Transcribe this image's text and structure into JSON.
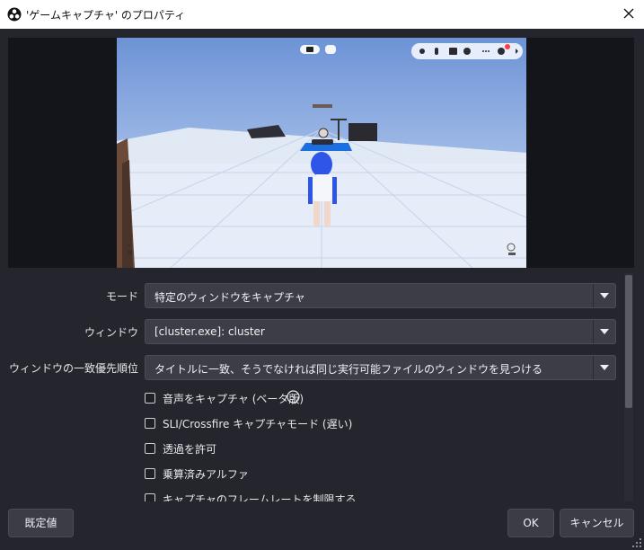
{
  "window": {
    "title": "'ゲームキャプチャ' のプロパティ",
    "icons": {
      "app": "obs-logo-icon",
      "close": "close-icon"
    }
  },
  "preview": {
    "description": "game-capture-preview",
    "hud_icons": [
      "chat-icon",
      "mic-muted-icon",
      "camera-icon",
      "emoji-icon",
      "more-icon",
      "settings-icon",
      "chevron-right-icon"
    ]
  },
  "form": {
    "mode": {
      "label": "モード",
      "value": "特定のウィンドウをキャプチャ"
    },
    "window": {
      "label": "ウィンドウ",
      "value": "[cluster.exe]: cluster"
    },
    "priority": {
      "label": "ウィンドウの一致優先順位",
      "value": "タイトルに一致、そうでなければ同じ実行可能ファイルのウィンドウを見つける"
    },
    "checkboxes": [
      {
        "label": "音声をキャプチャ (ベータ版)",
        "checked": false,
        "help": true
      },
      {
        "label": "SLI/Crossfire キャプチャモード (遅い)",
        "checked": false
      },
      {
        "label": "透過を許可",
        "checked": false
      },
      {
        "label": "乗算済みアルファ",
        "checked": false
      },
      {
        "label": "キャプチャのフレームレートを制限する",
        "checked": false
      }
    ]
  },
  "buttons": {
    "defaults": "既定値",
    "ok": "OK",
    "cancel": "キャンセル"
  },
  "colors": {
    "background": "#25262d",
    "input": "#3c3d46",
    "sky": "#7fa4dc",
    "floor": "#e8eefb",
    "avatar_hair": "#2d55e8"
  }
}
